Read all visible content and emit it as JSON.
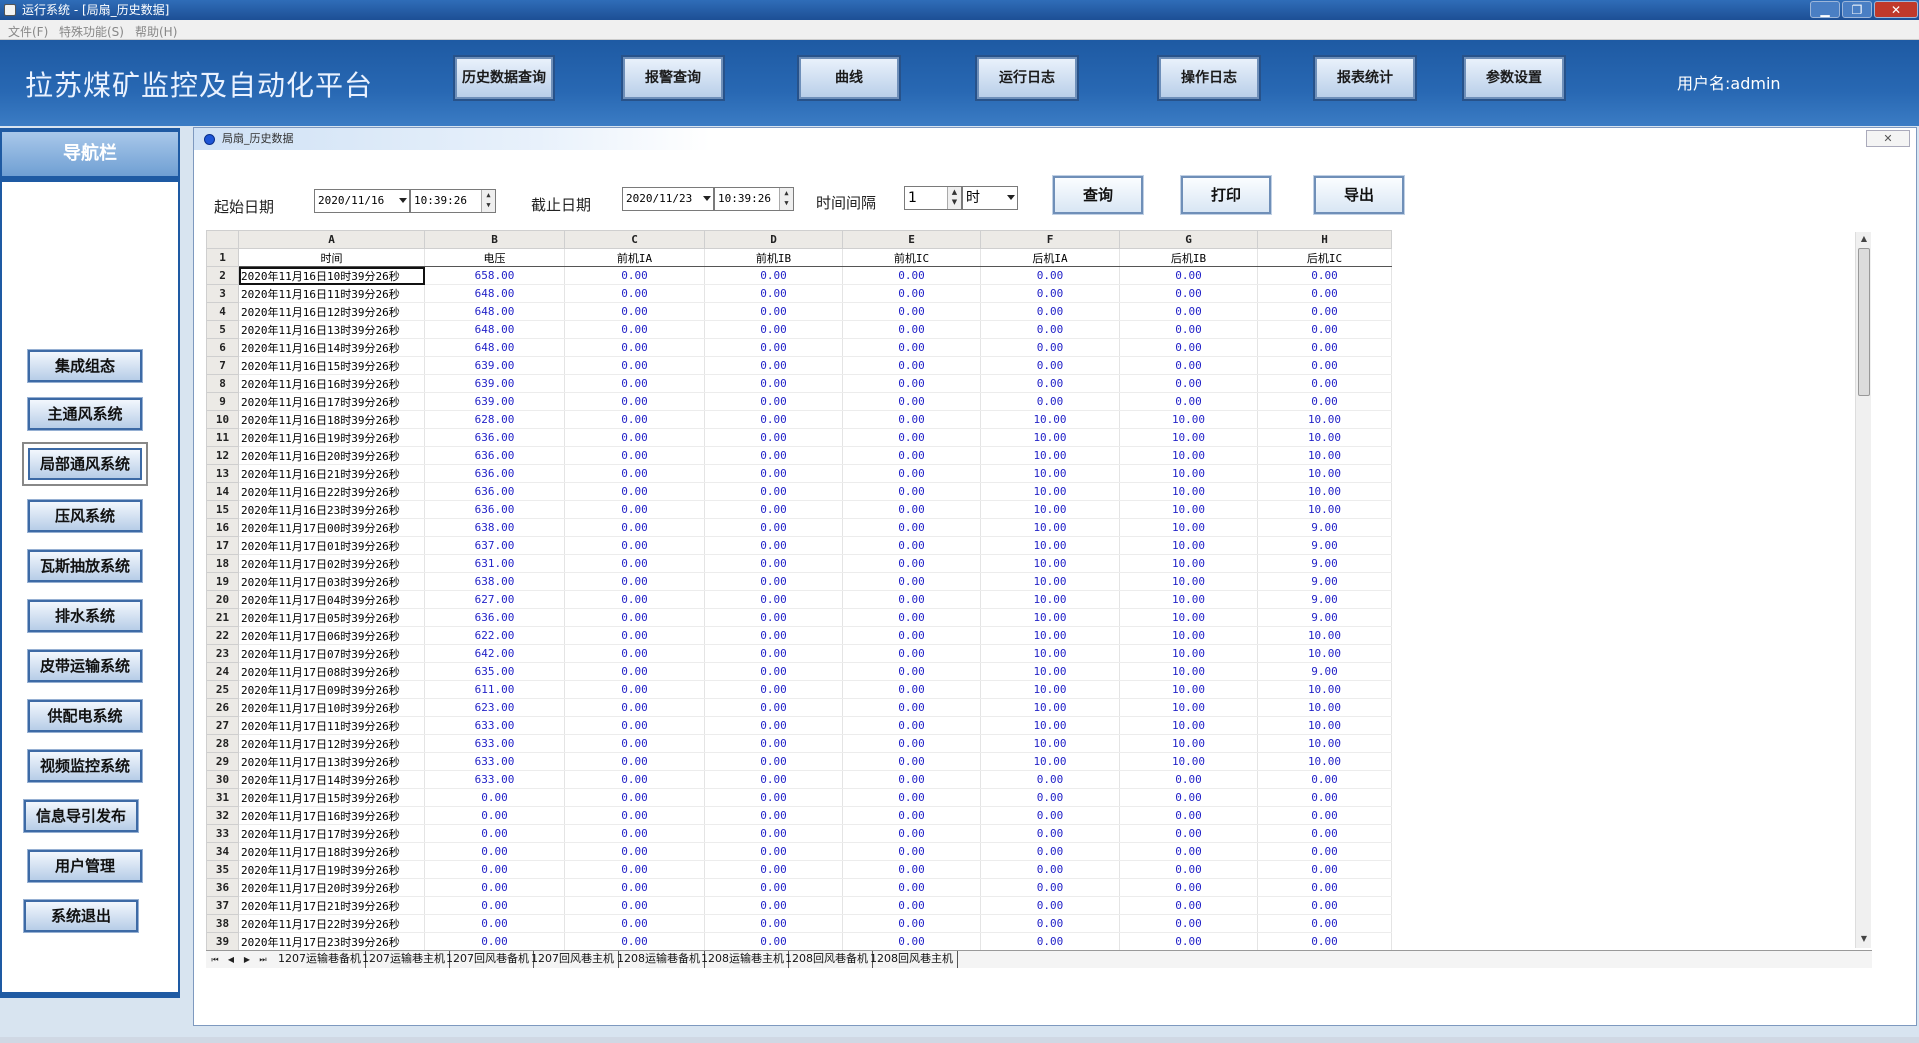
{
  "window": {
    "title": "运行系统 - [局扇_历史数据]",
    "min": "▁",
    "max": "❐",
    "close": "✕"
  },
  "menu": [
    "文件(F)",
    "特殊功能(S)",
    "帮助(H)"
  ],
  "header": {
    "title": "拉苏煤矿监控及自动化平台",
    "buttons": [
      "历史数据查询",
      "报警查询",
      "曲线",
      "运行日志",
      "操作日志",
      "报表统计",
      "参数设置"
    ],
    "user": "用户名:admin"
  },
  "sidebar": {
    "title": "导航栏",
    "items": [
      "集成组态",
      "主通风系统",
      "局部通风系统",
      "压风系统",
      "瓦斯抽放系统",
      "排水系统",
      "皮带运输系统",
      "供配电系统",
      "视频监控系统",
      "信息导引发布",
      "用户管理",
      "系统退出"
    ],
    "active_index": 2
  },
  "child": {
    "title": "局扇_历史数据",
    "close": "✕"
  },
  "query": {
    "start_label": "起始日期",
    "start_date": "2020/11/16",
    "start_time": "10:39:26",
    "end_label": "截止日期",
    "end_date": "2020/11/23",
    "end_time": "10:39:26",
    "interval_label": "时间间隔",
    "interval_value": "1",
    "interval_unit": "时",
    "buttons": {
      "query": "查询",
      "print": "打印",
      "export": "导出"
    }
  },
  "grid": {
    "col_letters": [
      "A",
      "B",
      "C",
      "D",
      "E",
      "F",
      "G",
      "H"
    ],
    "headers": [
      "时间",
      "电压",
      "前机IA",
      "前机IB",
      "前机IC",
      "后机IA",
      "后机IB",
      "后机IC"
    ],
    "rows": [
      [
        "2020年11月16日10时39分26秒",
        "658.00",
        "0.00",
        "0.00",
        "0.00",
        "0.00",
        "0.00",
        "0.00"
      ],
      [
        "2020年11月16日11时39分26秒",
        "648.00",
        "0.00",
        "0.00",
        "0.00",
        "0.00",
        "0.00",
        "0.00"
      ],
      [
        "2020年11月16日12时39分26秒",
        "648.00",
        "0.00",
        "0.00",
        "0.00",
        "0.00",
        "0.00",
        "0.00"
      ],
      [
        "2020年11月16日13时39分26秒",
        "648.00",
        "0.00",
        "0.00",
        "0.00",
        "0.00",
        "0.00",
        "0.00"
      ],
      [
        "2020年11月16日14时39分26秒",
        "648.00",
        "0.00",
        "0.00",
        "0.00",
        "0.00",
        "0.00",
        "0.00"
      ],
      [
        "2020年11月16日15时39分26秒",
        "639.00",
        "0.00",
        "0.00",
        "0.00",
        "0.00",
        "0.00",
        "0.00"
      ],
      [
        "2020年11月16日16时39分26秒",
        "639.00",
        "0.00",
        "0.00",
        "0.00",
        "0.00",
        "0.00",
        "0.00"
      ],
      [
        "2020年11月16日17时39分26秒",
        "639.00",
        "0.00",
        "0.00",
        "0.00",
        "0.00",
        "0.00",
        "0.00"
      ],
      [
        "2020年11月16日18时39分26秒",
        "628.00",
        "0.00",
        "0.00",
        "0.00",
        "10.00",
        "10.00",
        "10.00"
      ],
      [
        "2020年11月16日19时39分26秒",
        "636.00",
        "0.00",
        "0.00",
        "0.00",
        "10.00",
        "10.00",
        "10.00"
      ],
      [
        "2020年11月16日20时39分26秒",
        "636.00",
        "0.00",
        "0.00",
        "0.00",
        "10.00",
        "10.00",
        "10.00"
      ],
      [
        "2020年11月16日21时39分26秒",
        "636.00",
        "0.00",
        "0.00",
        "0.00",
        "10.00",
        "10.00",
        "10.00"
      ],
      [
        "2020年11月16日22时39分26秒",
        "636.00",
        "0.00",
        "0.00",
        "0.00",
        "10.00",
        "10.00",
        "10.00"
      ],
      [
        "2020年11月16日23时39分26秒",
        "636.00",
        "0.00",
        "0.00",
        "0.00",
        "10.00",
        "10.00",
        "10.00"
      ],
      [
        "2020年11月17日00时39分26秒",
        "638.00",
        "0.00",
        "0.00",
        "0.00",
        "10.00",
        "10.00",
        "9.00"
      ],
      [
        "2020年11月17日01时39分26秒",
        "637.00",
        "0.00",
        "0.00",
        "0.00",
        "10.00",
        "10.00",
        "9.00"
      ],
      [
        "2020年11月17日02时39分26秒",
        "631.00",
        "0.00",
        "0.00",
        "0.00",
        "10.00",
        "10.00",
        "9.00"
      ],
      [
        "2020年11月17日03时39分26秒",
        "638.00",
        "0.00",
        "0.00",
        "0.00",
        "10.00",
        "10.00",
        "9.00"
      ],
      [
        "2020年11月17日04时39分26秒",
        "627.00",
        "0.00",
        "0.00",
        "0.00",
        "10.00",
        "10.00",
        "9.00"
      ],
      [
        "2020年11月17日05时39分26秒",
        "636.00",
        "0.00",
        "0.00",
        "0.00",
        "10.00",
        "10.00",
        "9.00"
      ],
      [
        "2020年11月17日06时39分26秒",
        "622.00",
        "0.00",
        "0.00",
        "0.00",
        "10.00",
        "10.00",
        "10.00"
      ],
      [
        "2020年11月17日07时39分26秒",
        "642.00",
        "0.00",
        "0.00",
        "0.00",
        "10.00",
        "10.00",
        "10.00"
      ],
      [
        "2020年11月17日08时39分26秒",
        "635.00",
        "0.00",
        "0.00",
        "0.00",
        "10.00",
        "10.00",
        "9.00"
      ],
      [
        "2020年11月17日09时39分26秒",
        "611.00",
        "0.00",
        "0.00",
        "0.00",
        "10.00",
        "10.00",
        "10.00"
      ],
      [
        "2020年11月17日10时39分26秒",
        "623.00",
        "0.00",
        "0.00",
        "0.00",
        "10.00",
        "10.00",
        "10.00"
      ],
      [
        "2020年11月17日11时39分26秒",
        "633.00",
        "0.00",
        "0.00",
        "0.00",
        "10.00",
        "10.00",
        "10.00"
      ],
      [
        "2020年11月17日12时39分26秒",
        "633.00",
        "0.00",
        "0.00",
        "0.00",
        "10.00",
        "10.00",
        "10.00"
      ],
      [
        "2020年11月17日13时39分26秒",
        "633.00",
        "0.00",
        "0.00",
        "0.00",
        "10.00",
        "10.00",
        "10.00"
      ],
      [
        "2020年11月17日14时39分26秒",
        "633.00",
        "0.00",
        "0.00",
        "0.00",
        "0.00",
        "0.00",
        "0.00"
      ],
      [
        "2020年11月17日15时39分26秒",
        "0.00",
        "0.00",
        "0.00",
        "0.00",
        "0.00",
        "0.00",
        "0.00"
      ],
      [
        "2020年11月17日16时39分26秒",
        "0.00",
        "0.00",
        "0.00",
        "0.00",
        "0.00",
        "0.00",
        "0.00"
      ],
      [
        "2020年11月17日17时39分26秒",
        "0.00",
        "0.00",
        "0.00",
        "0.00",
        "0.00",
        "0.00",
        "0.00"
      ],
      [
        "2020年11月17日18时39分26秒",
        "0.00",
        "0.00",
        "0.00",
        "0.00",
        "0.00",
        "0.00",
        "0.00"
      ],
      [
        "2020年11月17日19时39分26秒",
        "0.00",
        "0.00",
        "0.00",
        "0.00",
        "0.00",
        "0.00",
        "0.00"
      ],
      [
        "2020年11月17日20时39分26秒",
        "0.00",
        "0.00",
        "0.00",
        "0.00",
        "0.00",
        "0.00",
        "0.00"
      ],
      [
        "2020年11月17日21时39分26秒",
        "0.00",
        "0.00",
        "0.00",
        "0.00",
        "0.00",
        "0.00",
        "0.00"
      ],
      [
        "2020年11月17日22时39分26秒",
        "0.00",
        "0.00",
        "0.00",
        "0.00",
        "0.00",
        "0.00",
        "0.00"
      ],
      [
        "2020年11月17日23时39分26秒",
        "0.00",
        "0.00",
        "0.00",
        "0.00",
        "0.00",
        "0.00",
        "0.00"
      ]
    ]
  },
  "sheet_tabs": [
    "1207运输巷备机",
    "1207运输巷主机",
    "1207回风巷备机",
    "1207回风巷主机",
    "1208运输巷备机",
    "1208运输巷主机",
    "1208回风巷备机",
    "1208回风巷主机"
  ],
  "tab_nav": [
    "⏮",
    "◀",
    "▶",
    "⏭"
  ]
}
